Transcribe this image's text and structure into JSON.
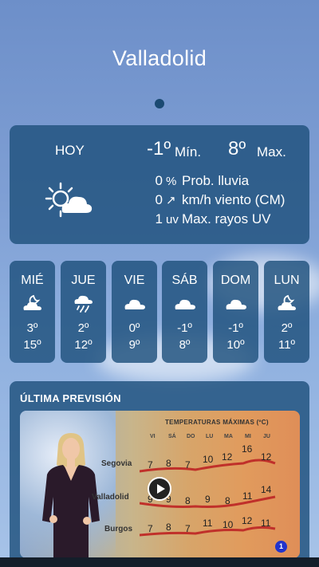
{
  "city": "Valladolid",
  "today": {
    "label": "HOY",
    "min_value": "-1º",
    "min_label": "Mín.",
    "max_value": "8º",
    "max_label": "Max.",
    "icon": "partly-sunny-icon",
    "stats": [
      {
        "value": "0",
        "unit": "%",
        "desc": "Prob. lluvia"
      },
      {
        "value": "0",
        "unit": "↗",
        "desc": "km/h viento (CM)"
      },
      {
        "value": "1",
        "unit": "uv",
        "desc": "Max. rayos UV"
      }
    ]
  },
  "days": [
    {
      "name": "MIÉ",
      "icon": "cloud-moon-icon",
      "min": "3º",
      "max": "15º"
    },
    {
      "name": "JUE",
      "icon": "rain-icon",
      "min": "2º",
      "max": "12º"
    },
    {
      "name": "VIE",
      "icon": "cloud-icon",
      "min": "0º",
      "max": "9º"
    },
    {
      "name": "SÁB",
      "icon": "cloud-icon",
      "min": "-1º",
      "max": "8º"
    },
    {
      "name": "DOM",
      "icon": "cloud-icon",
      "min": "-1º",
      "max": "10º"
    },
    {
      "name": "LUN",
      "icon": "cloud-moon-icon",
      "min": "2º",
      "max": "11º"
    }
  ],
  "forecast": {
    "title": "ÚLTIMA PREVISIÓN",
    "video": {
      "heading": "TEMPERATURAS MÁXIMAS (ºC)",
      "day_labels": [
        "VI",
        "SÁ",
        "DO",
        "LU",
        "MA",
        "MI",
        "JU"
      ],
      "rows": [
        {
          "city": "Segovia",
          "values": [
            "7",
            "8",
            "7",
            "10",
            "12",
            "16",
            "12"
          ]
        },
        {
          "city": "Valladolid",
          "values": [
            "9",
            "9",
            "8",
            "9",
            "8",
            "11",
            "14"
          ]
        },
        {
          "city": "Burgos",
          "values": [
            "7",
            "8",
            "7",
            "11",
            "10",
            "12",
            "11"
          ]
        }
      ],
      "badge": "1"
    }
  }
}
